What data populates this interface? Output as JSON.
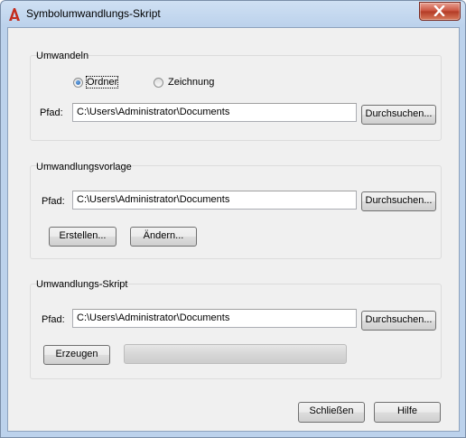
{
  "window": {
    "title": "Symbolumwandlungs-Skript",
    "icon": "autocad-a-icon",
    "accent": "#c42b1c"
  },
  "umwandeln": {
    "group_label": "Umwandeln",
    "radio_ordner": "Ordner",
    "radio_zeichnung": "Zeichnung",
    "selected": "Ordner",
    "path_label": "Pfad:",
    "path_value": "C:\\Users\\Administrator\\Documents",
    "browse_label": "Durchsuchen..."
  },
  "vorlage": {
    "group_label": "Umwandlungsvorlage",
    "path_label": "Pfad:",
    "path_value": "C:\\Users\\Administrator\\Documents",
    "browse_label": "Durchsuchen...",
    "create_label": "Erstellen...",
    "edit_label": "Ändern..."
  },
  "skript": {
    "group_label": "Umwandlungs-Skript",
    "path_label": "Pfad:",
    "path_value": "C:\\Users\\Administrator\\Documents",
    "browse_label": "Durchsuchen...",
    "generate_label": "Erzeugen",
    "progress": 0
  },
  "footer": {
    "close_label": "Schließen",
    "help_label": "Hilfe"
  }
}
